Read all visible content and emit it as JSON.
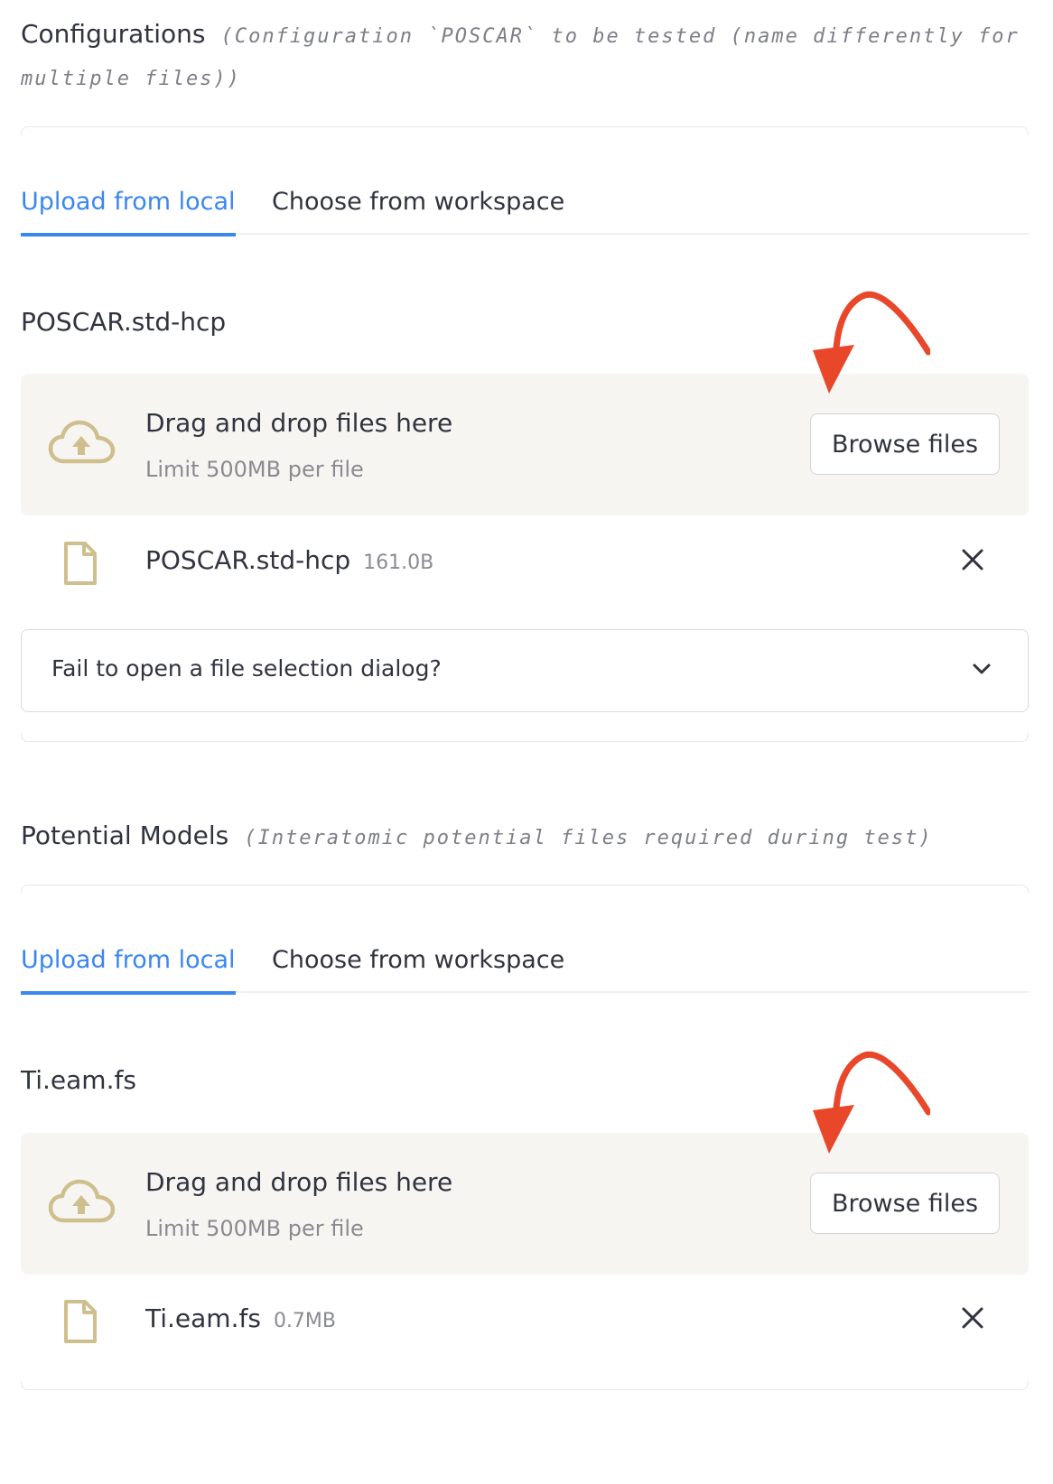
{
  "sections": [
    {
      "title": "Configurations",
      "description_line1": "(Configuration `POSCAR` to be tested (name differently for",
      "description_line2": "multiple files))",
      "tabs": [
        "Upload from local",
        "Choose from workspace"
      ],
      "active_tab": 0,
      "file_label": "POSCAR.std-hcp",
      "dropzone": {
        "title": "Drag and drop files here",
        "limit": "Limit 500MB per file",
        "button": "Browse files"
      },
      "uploaded_file": {
        "name": "POSCAR.std-hcp",
        "size": "161.0B"
      },
      "expander_label": "Fail to open a file selection dialog?"
    },
    {
      "title": "Potential Models",
      "description_line1": "(Interatomic potential files required during test)",
      "tabs": [
        "Upload from local",
        "Choose from workspace"
      ],
      "active_tab": 0,
      "file_label": "Ti.eam.fs",
      "dropzone": {
        "title": "Drag and drop files here",
        "limit": "Limit 500MB per file",
        "button": "Browse files"
      },
      "uploaded_file": {
        "name": "Ti.eam.fs",
        "size": "0.7MB"
      }
    }
  ],
  "colors": {
    "accent": "#3a87f0",
    "annotation_arrow": "#e8472a",
    "dropzone_bg": "#f7f5f1",
    "icon_tan": "#cfbf8f"
  },
  "icons": [
    "cloud-upload-icon",
    "file-icon",
    "close-icon",
    "chevron-down-icon",
    "annotation-arrow"
  ]
}
